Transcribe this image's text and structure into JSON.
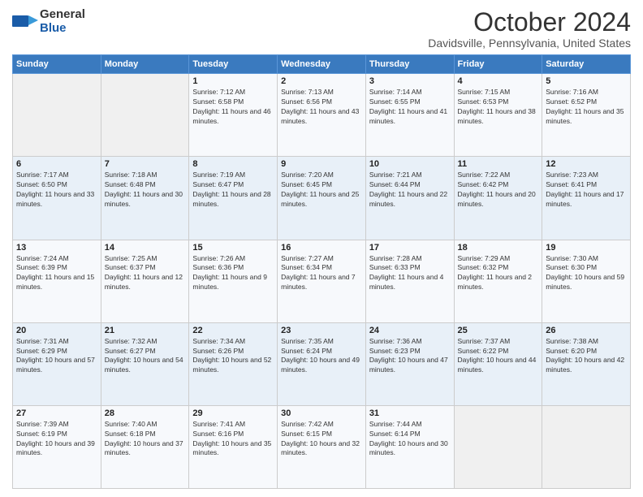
{
  "header": {
    "logo_general": "General",
    "logo_blue": "Blue",
    "month_title": "October 2024",
    "location": "Davidsville, Pennsylvania, United States"
  },
  "days_of_week": [
    "Sunday",
    "Monday",
    "Tuesday",
    "Wednesday",
    "Thursday",
    "Friday",
    "Saturday"
  ],
  "weeks": [
    [
      {
        "day": "",
        "sunrise": "",
        "sunset": "",
        "daylight": ""
      },
      {
        "day": "",
        "sunrise": "",
        "sunset": "",
        "daylight": ""
      },
      {
        "day": "1",
        "sunrise": "Sunrise: 7:12 AM",
        "sunset": "Sunset: 6:58 PM",
        "daylight": "Daylight: 11 hours and 46 minutes."
      },
      {
        "day": "2",
        "sunrise": "Sunrise: 7:13 AM",
        "sunset": "Sunset: 6:56 PM",
        "daylight": "Daylight: 11 hours and 43 minutes."
      },
      {
        "day": "3",
        "sunrise": "Sunrise: 7:14 AM",
        "sunset": "Sunset: 6:55 PM",
        "daylight": "Daylight: 11 hours and 41 minutes."
      },
      {
        "day": "4",
        "sunrise": "Sunrise: 7:15 AM",
        "sunset": "Sunset: 6:53 PM",
        "daylight": "Daylight: 11 hours and 38 minutes."
      },
      {
        "day": "5",
        "sunrise": "Sunrise: 7:16 AM",
        "sunset": "Sunset: 6:52 PM",
        "daylight": "Daylight: 11 hours and 35 minutes."
      }
    ],
    [
      {
        "day": "6",
        "sunrise": "Sunrise: 7:17 AM",
        "sunset": "Sunset: 6:50 PM",
        "daylight": "Daylight: 11 hours and 33 minutes."
      },
      {
        "day": "7",
        "sunrise": "Sunrise: 7:18 AM",
        "sunset": "Sunset: 6:48 PM",
        "daylight": "Daylight: 11 hours and 30 minutes."
      },
      {
        "day": "8",
        "sunrise": "Sunrise: 7:19 AM",
        "sunset": "Sunset: 6:47 PM",
        "daylight": "Daylight: 11 hours and 28 minutes."
      },
      {
        "day": "9",
        "sunrise": "Sunrise: 7:20 AM",
        "sunset": "Sunset: 6:45 PM",
        "daylight": "Daylight: 11 hours and 25 minutes."
      },
      {
        "day": "10",
        "sunrise": "Sunrise: 7:21 AM",
        "sunset": "Sunset: 6:44 PM",
        "daylight": "Daylight: 11 hours and 22 minutes."
      },
      {
        "day": "11",
        "sunrise": "Sunrise: 7:22 AM",
        "sunset": "Sunset: 6:42 PM",
        "daylight": "Daylight: 11 hours and 20 minutes."
      },
      {
        "day": "12",
        "sunrise": "Sunrise: 7:23 AM",
        "sunset": "Sunset: 6:41 PM",
        "daylight": "Daylight: 11 hours and 17 minutes."
      }
    ],
    [
      {
        "day": "13",
        "sunrise": "Sunrise: 7:24 AM",
        "sunset": "Sunset: 6:39 PM",
        "daylight": "Daylight: 11 hours and 15 minutes."
      },
      {
        "day": "14",
        "sunrise": "Sunrise: 7:25 AM",
        "sunset": "Sunset: 6:37 PM",
        "daylight": "Daylight: 11 hours and 12 minutes."
      },
      {
        "day": "15",
        "sunrise": "Sunrise: 7:26 AM",
        "sunset": "Sunset: 6:36 PM",
        "daylight": "Daylight: 11 hours and 9 minutes."
      },
      {
        "day": "16",
        "sunrise": "Sunrise: 7:27 AM",
        "sunset": "Sunset: 6:34 PM",
        "daylight": "Daylight: 11 hours and 7 minutes."
      },
      {
        "day": "17",
        "sunrise": "Sunrise: 7:28 AM",
        "sunset": "Sunset: 6:33 PM",
        "daylight": "Daylight: 11 hours and 4 minutes."
      },
      {
        "day": "18",
        "sunrise": "Sunrise: 7:29 AM",
        "sunset": "Sunset: 6:32 PM",
        "daylight": "Daylight: 11 hours and 2 minutes."
      },
      {
        "day": "19",
        "sunrise": "Sunrise: 7:30 AM",
        "sunset": "Sunset: 6:30 PM",
        "daylight": "Daylight: 10 hours and 59 minutes."
      }
    ],
    [
      {
        "day": "20",
        "sunrise": "Sunrise: 7:31 AM",
        "sunset": "Sunset: 6:29 PM",
        "daylight": "Daylight: 10 hours and 57 minutes."
      },
      {
        "day": "21",
        "sunrise": "Sunrise: 7:32 AM",
        "sunset": "Sunset: 6:27 PM",
        "daylight": "Daylight: 10 hours and 54 minutes."
      },
      {
        "day": "22",
        "sunrise": "Sunrise: 7:34 AM",
        "sunset": "Sunset: 6:26 PM",
        "daylight": "Daylight: 10 hours and 52 minutes."
      },
      {
        "day": "23",
        "sunrise": "Sunrise: 7:35 AM",
        "sunset": "Sunset: 6:24 PM",
        "daylight": "Daylight: 10 hours and 49 minutes."
      },
      {
        "day": "24",
        "sunrise": "Sunrise: 7:36 AM",
        "sunset": "Sunset: 6:23 PM",
        "daylight": "Daylight: 10 hours and 47 minutes."
      },
      {
        "day": "25",
        "sunrise": "Sunrise: 7:37 AM",
        "sunset": "Sunset: 6:22 PM",
        "daylight": "Daylight: 10 hours and 44 minutes."
      },
      {
        "day": "26",
        "sunrise": "Sunrise: 7:38 AM",
        "sunset": "Sunset: 6:20 PM",
        "daylight": "Daylight: 10 hours and 42 minutes."
      }
    ],
    [
      {
        "day": "27",
        "sunrise": "Sunrise: 7:39 AM",
        "sunset": "Sunset: 6:19 PM",
        "daylight": "Daylight: 10 hours and 39 minutes."
      },
      {
        "day": "28",
        "sunrise": "Sunrise: 7:40 AM",
        "sunset": "Sunset: 6:18 PM",
        "daylight": "Daylight: 10 hours and 37 minutes."
      },
      {
        "day": "29",
        "sunrise": "Sunrise: 7:41 AM",
        "sunset": "Sunset: 6:16 PM",
        "daylight": "Daylight: 10 hours and 35 minutes."
      },
      {
        "day": "30",
        "sunrise": "Sunrise: 7:42 AM",
        "sunset": "Sunset: 6:15 PM",
        "daylight": "Daylight: 10 hours and 32 minutes."
      },
      {
        "day": "31",
        "sunrise": "Sunrise: 7:44 AM",
        "sunset": "Sunset: 6:14 PM",
        "daylight": "Daylight: 10 hours and 30 minutes."
      },
      {
        "day": "",
        "sunrise": "",
        "sunset": "",
        "daylight": ""
      },
      {
        "day": "",
        "sunrise": "",
        "sunset": "",
        "daylight": ""
      }
    ]
  ]
}
